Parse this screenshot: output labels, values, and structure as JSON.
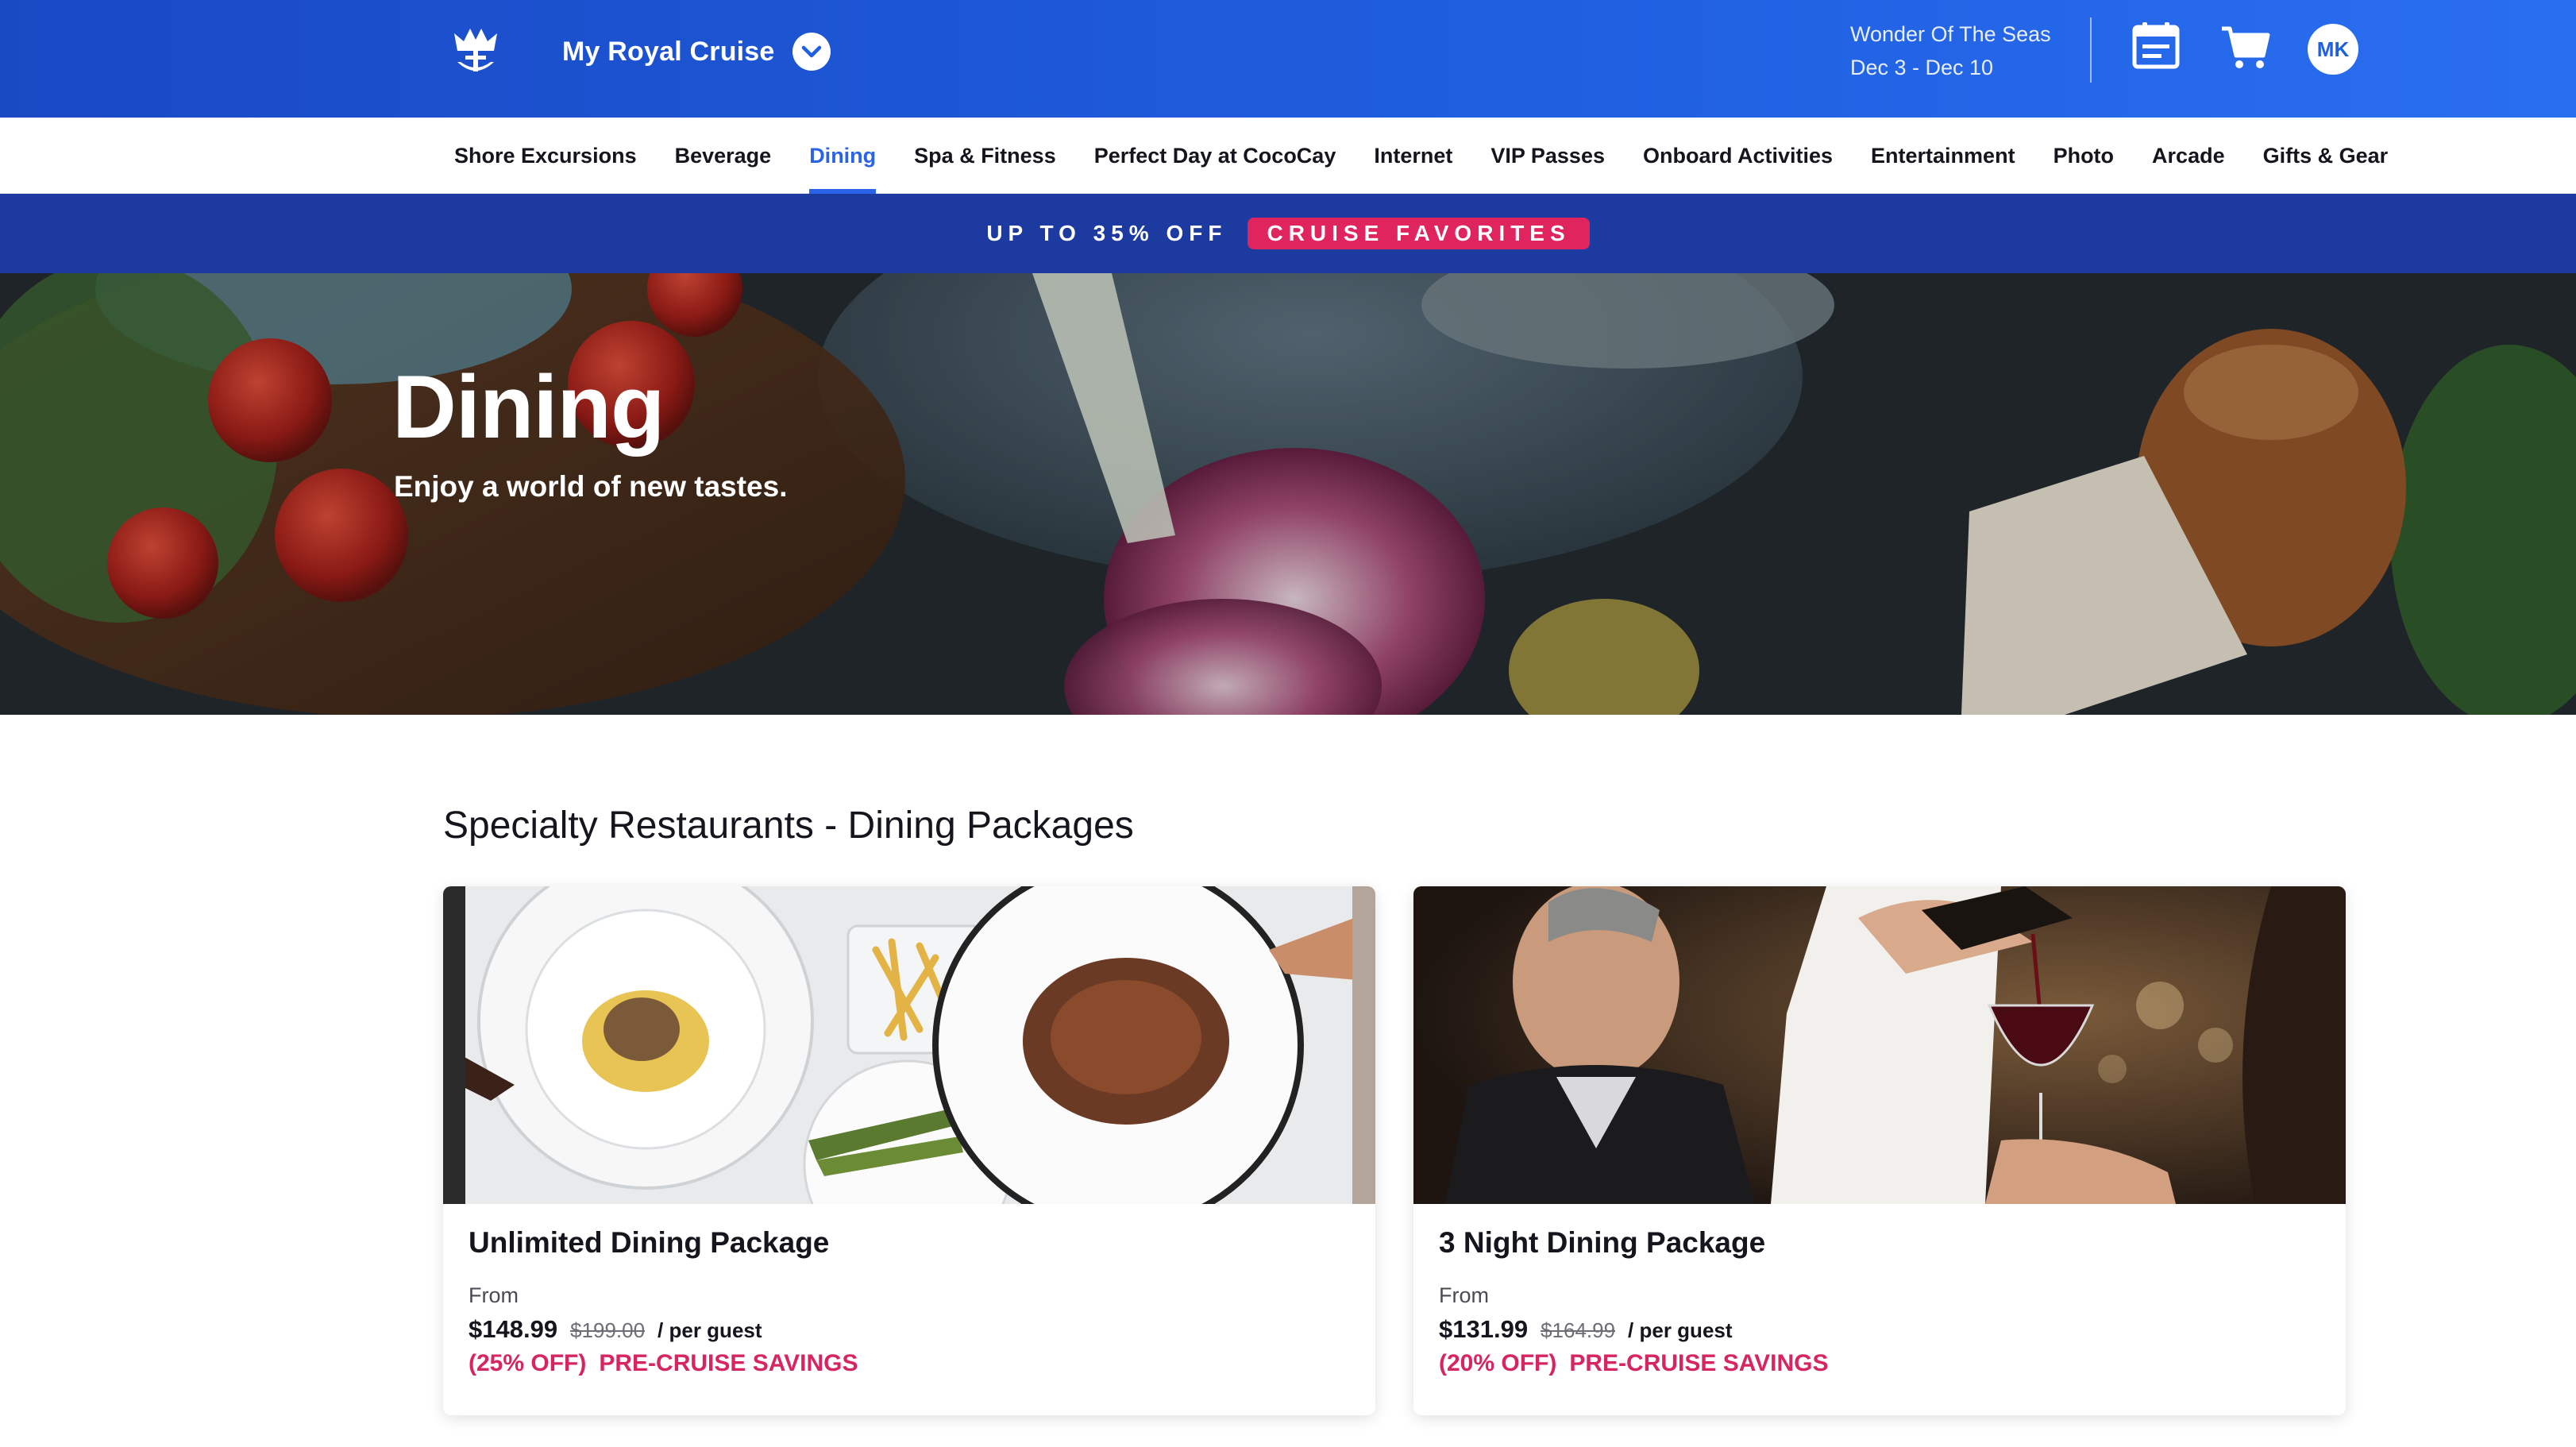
{
  "header": {
    "brand_title": "My Royal Cruise",
    "ship_name": "Wonder Of The Seas",
    "sail_dates": "Dec 3 - Dec 10",
    "avatar_initials": "MK",
    "colors": {
      "background": "#1f5fe0",
      "accent": "#2a63e8"
    },
    "icons": [
      "crown-anchor-logo-icon",
      "chevron-down-icon",
      "calendar-icon",
      "cart-icon"
    ]
  },
  "nav": {
    "items": [
      {
        "label": "Shore Excursions"
      },
      {
        "label": "Beverage"
      },
      {
        "label": "Dining"
      },
      {
        "label": "Spa & Fitness"
      },
      {
        "label": "Perfect Day at CocoCay"
      },
      {
        "label": "Internet"
      },
      {
        "label": "VIP Passes"
      },
      {
        "label": "Onboard Activities"
      },
      {
        "label": "Entertainment"
      },
      {
        "label": "Photo"
      },
      {
        "label": "Arcade"
      },
      {
        "label": "Gifts & Gear"
      }
    ],
    "active": "Dining"
  },
  "promo": {
    "text": "UP TO 35% OFF",
    "badge": "CRUISE FAVORITES",
    "colors": {
      "background": "#1d3aa0",
      "badge": "#e0245e"
    }
  },
  "hero": {
    "title": "Dining",
    "subtitle": "Enjoy a world of new tastes."
  },
  "section": {
    "title": "Specialty Restaurants - Dining Packages",
    "cards": [
      {
        "title": "Unlimited Dining Package",
        "from_label": "From",
        "price": "$148.99",
        "old_price": "$199.00",
        "per_guest": "/ per guest",
        "discount": "(25% OFF)",
        "savings_label": "PRE-CRUISE SAVINGS"
      },
      {
        "title": "3 Night Dining Package",
        "from_label": "From",
        "price": "$131.99",
        "old_price": "$164.99",
        "per_guest": "/ per guest",
        "discount": "(20% OFF)",
        "savings_label": "PRE-CRUISE SAVINGS"
      }
    ],
    "colors": {
      "savings": "#d7265f"
    }
  }
}
